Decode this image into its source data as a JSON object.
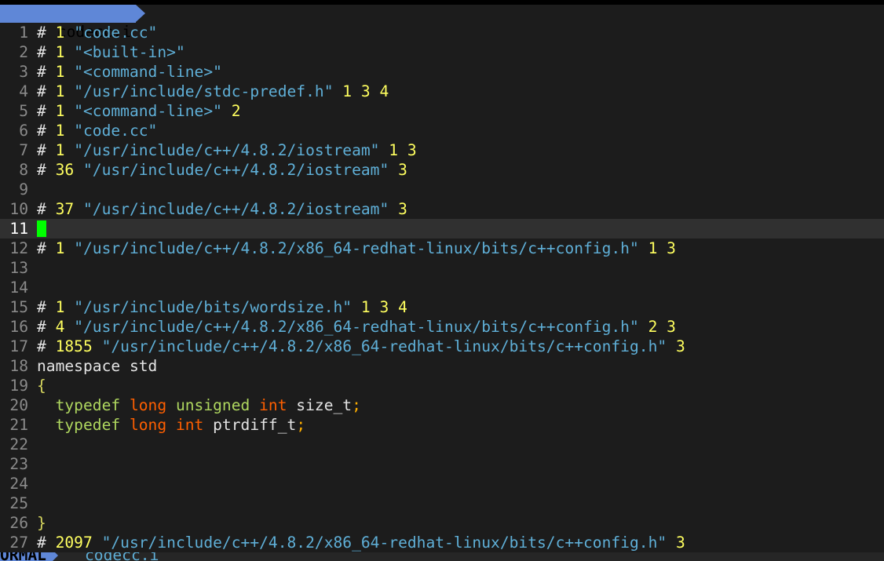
{
  "tabline": {
    "tab_label": ": codecc.i"
  },
  "status": {
    "mode": "ORMAL",
    "filename": "codecc.i"
  },
  "cursor_line": 11,
  "lines": [
    {
      "n": "1",
      "parts": [
        [
          "hash",
          "# "
        ],
        [
          "num",
          "1"
        ],
        [
          "plain",
          " "
        ],
        [
          "str",
          "\"code.cc\""
        ]
      ]
    },
    {
      "n": "2",
      "parts": [
        [
          "hash",
          "# "
        ],
        [
          "num",
          "1"
        ],
        [
          "plain",
          " "
        ],
        [
          "str",
          "\"<built-in>\""
        ]
      ]
    },
    {
      "n": "3",
      "parts": [
        [
          "hash",
          "# "
        ],
        [
          "num",
          "1"
        ],
        [
          "plain",
          " "
        ],
        [
          "str",
          "\"<command-line>\""
        ]
      ]
    },
    {
      "n": "4",
      "parts": [
        [
          "hash",
          "# "
        ],
        [
          "num",
          "1"
        ],
        [
          "plain",
          " "
        ],
        [
          "str",
          "\"/usr/include/stdc-predef.h\""
        ],
        [
          "plain",
          " "
        ],
        [
          "num",
          "1 3 4"
        ]
      ]
    },
    {
      "n": "5",
      "parts": [
        [
          "hash",
          "# "
        ],
        [
          "num",
          "1"
        ],
        [
          "plain",
          " "
        ],
        [
          "str",
          "\"<command-line>\""
        ],
        [
          "plain",
          " "
        ],
        [
          "num",
          "2"
        ]
      ]
    },
    {
      "n": "6",
      "parts": [
        [
          "hash",
          "# "
        ],
        [
          "num",
          "1"
        ],
        [
          "plain",
          " "
        ],
        [
          "str",
          "\"code.cc\""
        ]
      ]
    },
    {
      "n": "7",
      "parts": [
        [
          "hash",
          "# "
        ],
        [
          "num",
          "1"
        ],
        [
          "plain",
          " "
        ],
        [
          "str",
          "\"/usr/include/c++/4.8.2/iostream\""
        ],
        [
          "plain",
          " "
        ],
        [
          "num",
          "1 3"
        ]
      ]
    },
    {
      "n": "8",
      "parts": [
        [
          "hash",
          "# "
        ],
        [
          "num",
          "36"
        ],
        [
          "plain",
          " "
        ],
        [
          "str",
          "\"/usr/include/c++/4.8.2/iostream\""
        ],
        [
          "plain",
          " "
        ],
        [
          "num",
          "3"
        ]
      ]
    },
    {
      "n": "9",
      "parts": []
    },
    {
      "n": "10",
      "parts": [
        [
          "hash",
          "# "
        ],
        [
          "num",
          "37"
        ],
        [
          "plain",
          " "
        ],
        [
          "str",
          "\"/usr/include/c++/4.8.2/iostream\""
        ],
        [
          "plain",
          " "
        ],
        [
          "num",
          "3"
        ]
      ]
    },
    {
      "n": "11",
      "parts": [],
      "cursor": true
    },
    {
      "n": "12",
      "parts": [
        [
          "hash",
          "# "
        ],
        [
          "num",
          "1"
        ],
        [
          "plain",
          " "
        ],
        [
          "str",
          "\"/usr/include/c++/4.8.2/x86_64-redhat-linux/bits/c++config.h\""
        ],
        [
          "plain",
          " "
        ],
        [
          "num",
          "1 3"
        ]
      ]
    },
    {
      "n": "13",
      "parts": []
    },
    {
      "n": "14",
      "parts": []
    },
    {
      "n": "15",
      "parts": [
        [
          "hash",
          "# "
        ],
        [
          "num",
          "1"
        ],
        [
          "plain",
          " "
        ],
        [
          "str",
          "\"/usr/include/bits/wordsize.h\""
        ],
        [
          "plain",
          " "
        ],
        [
          "num",
          "1 3 4"
        ]
      ]
    },
    {
      "n": "16",
      "parts": [
        [
          "hash",
          "# "
        ],
        [
          "num",
          "4"
        ],
        [
          "plain",
          " "
        ],
        [
          "str",
          "\"/usr/include/c++/4.8.2/x86_64-redhat-linux/bits/c++config.h\""
        ],
        [
          "plain",
          " "
        ],
        [
          "num",
          "2 3"
        ]
      ]
    },
    {
      "n": "17",
      "parts": [
        [
          "hash",
          "# "
        ],
        [
          "num",
          "1855"
        ],
        [
          "plain",
          " "
        ],
        [
          "str",
          "\"/usr/include/c++/4.8.2/x86_64-redhat-linux/bits/c++config.h\""
        ],
        [
          "plain",
          " "
        ],
        [
          "num",
          "3"
        ]
      ]
    },
    {
      "n": "18",
      "parts": [
        [
          "plain",
          "namespace std"
        ]
      ]
    },
    {
      "n": "19",
      "parts": [
        [
          "brace",
          "{"
        ]
      ]
    },
    {
      "n": "20",
      "parts": [
        [
          "plain",
          "  "
        ],
        [
          "kw-type",
          "typedef"
        ],
        [
          "plain",
          " "
        ],
        [
          "kw-mod",
          "long"
        ],
        [
          "plain",
          " "
        ],
        [
          "kw-type",
          "unsigned"
        ],
        [
          "plain",
          " "
        ],
        [
          "kw-mod",
          "int"
        ],
        [
          "plain",
          " size_t"
        ],
        [
          "punct",
          ";"
        ]
      ]
    },
    {
      "n": "21",
      "parts": [
        [
          "plain",
          "  "
        ],
        [
          "kw-type",
          "typedef"
        ],
        [
          "plain",
          " "
        ],
        [
          "kw-mod",
          "long"
        ],
        [
          "plain",
          " "
        ],
        [
          "kw-mod",
          "int"
        ],
        [
          "plain",
          " ptrdiff_t"
        ],
        [
          "punct",
          ";"
        ]
      ]
    },
    {
      "n": "22",
      "parts": []
    },
    {
      "n": "23",
      "parts": []
    },
    {
      "n": "24",
      "parts": []
    },
    {
      "n": "25",
      "parts": []
    },
    {
      "n": "26",
      "parts": [
        [
          "brace",
          "}"
        ]
      ]
    },
    {
      "n": "27",
      "parts": [
        [
          "hash",
          "# "
        ],
        [
          "num",
          "2097"
        ],
        [
          "plain",
          " "
        ],
        [
          "str",
          "\"/usr/include/c++/4.8.2/x86_64-redhat-linux/bits/c++config.h\""
        ],
        [
          "plain",
          " "
        ],
        [
          "num",
          "3"
        ]
      ]
    }
  ],
  "colors": {
    "background": "#1c1c1c",
    "tab_accent": "#5f87d7",
    "cursor": "#00ff00",
    "string": "#5fafd7",
    "number": "#ffff5f",
    "type_keyword": "#afd75f",
    "modifier_keyword": "#ff5f00"
  }
}
